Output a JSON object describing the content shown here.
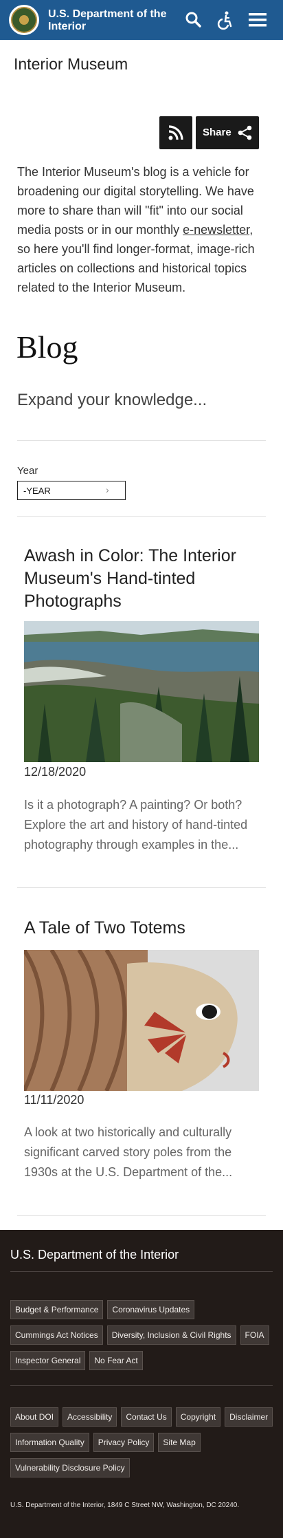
{
  "header": {
    "agency_name": "U.S. Department of the Interior",
    "icons": [
      "doi-seal-icon",
      "search-icon",
      "accessibility-icon",
      "menu-icon"
    ],
    "background_color": "#1f5a91"
  },
  "site_title": "Interior Museum",
  "share": {
    "label": "Share"
  },
  "intro": {
    "text_before_link": "The Interior Museum's blog is a vehicle for broadening our digital storytelling. We have more to share than will \"fit\" into our social media posts or in our monthly ",
    "link_text": "e-newsletter",
    "text_after_link": ", so here you'll find longer-format, image-rich articles on collections and historical topics related to the Interior Museum."
  },
  "blog_heading": "Blog",
  "subheading": "Expand your knowledge...",
  "filter": {
    "year_label": "Year",
    "year_value": "-YEAR"
  },
  "articles": [
    {
      "title": "Awash in Color: The Interior Museum's Hand-tinted Photographs",
      "date": "12/18/2020",
      "summary": "Is it a photograph? A painting? Or both? Explore the art and history of hand-tinted photography through examples in the..."
    },
    {
      "title": "A Tale of Two Totems",
      "date": "11/11/2020",
      "summary": "A look at two historically and culturally significant carved story poles from the 1930s at the U.S. Department of the..."
    }
  ],
  "footer": {
    "title": "U.S. Department of the Interior",
    "links_group_1": [
      "Budget & Performance",
      "Coronavirus Updates",
      "Cummings Act Notices",
      "Diversity, Inclusion & Civil Rights",
      "FOIA",
      "Inspector General",
      "No Fear Act"
    ],
    "links_group_2": [
      "About DOI",
      "Accessibility",
      "Contact Us",
      "Copyright",
      "Disclaimer",
      "Information Quality",
      "Privacy Policy",
      "Site Map",
      "Vulnerability Disclosure Policy"
    ],
    "address": "U.S. Department of the Interior, 1849 C Street NW, Washington, DC 20240."
  }
}
